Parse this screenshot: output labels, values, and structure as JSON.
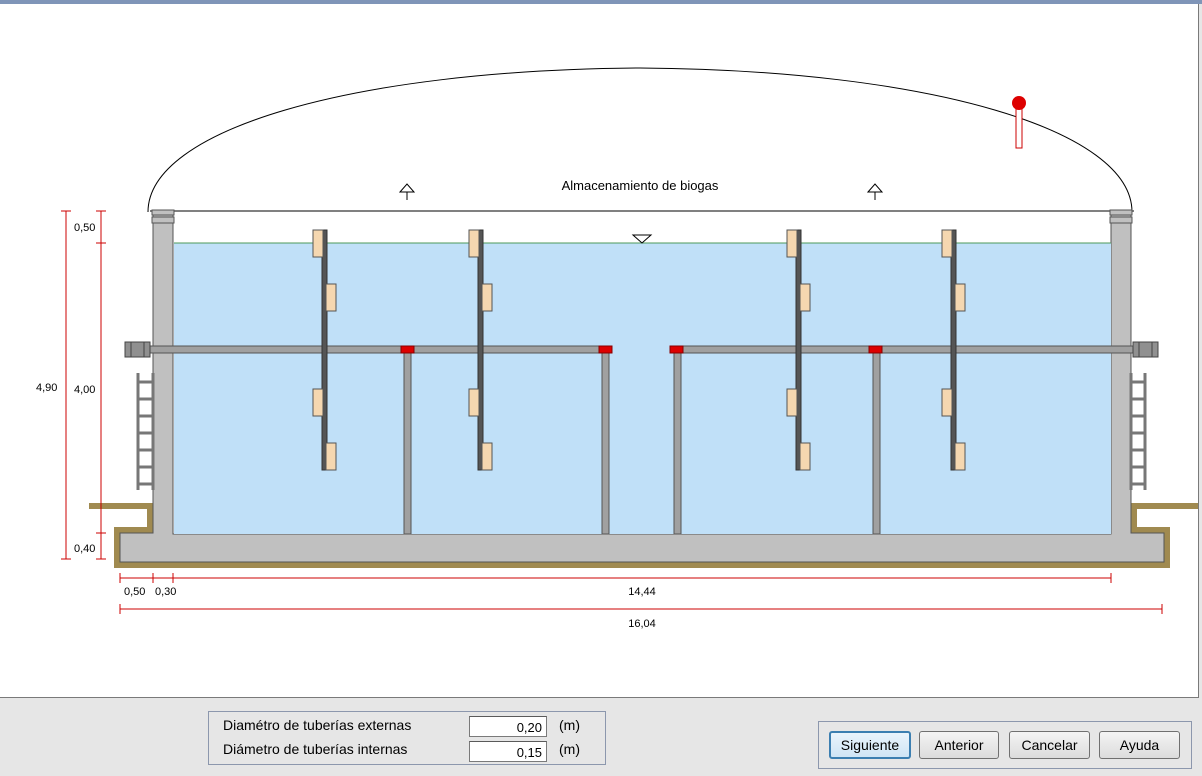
{
  "drawing": {
    "label_storage": "Almacenamiento de biogas",
    "dim_total_height": "4,90",
    "dim_freeboard": "0,50",
    "dim_liquid_height": "4,00",
    "dim_slab": "0,40",
    "dim_left_a": "0,50",
    "dim_left_b": "0,30",
    "dim_inner_width": "14,44",
    "dim_total_width": "16,04"
  },
  "params": {
    "external_label": "Diamétro de tuberías externas",
    "external_value": "0,20",
    "external_unit": "(m)",
    "internal_label": "Diámetro de tuberías internas",
    "internal_value": "0,15",
    "internal_unit": "(m)"
  },
  "buttons": {
    "next": "Siguiente",
    "previous": "Anterior",
    "cancel": "Cancelar",
    "help": "Ayuda"
  },
  "colors": {
    "liquid": "#c0e0f8",
    "concrete": "#c0c0c0",
    "soil": "#a08a50",
    "dimension": "#cc0000",
    "valve": "#dd0000",
    "heater_block": "#f5d7b0"
  }
}
